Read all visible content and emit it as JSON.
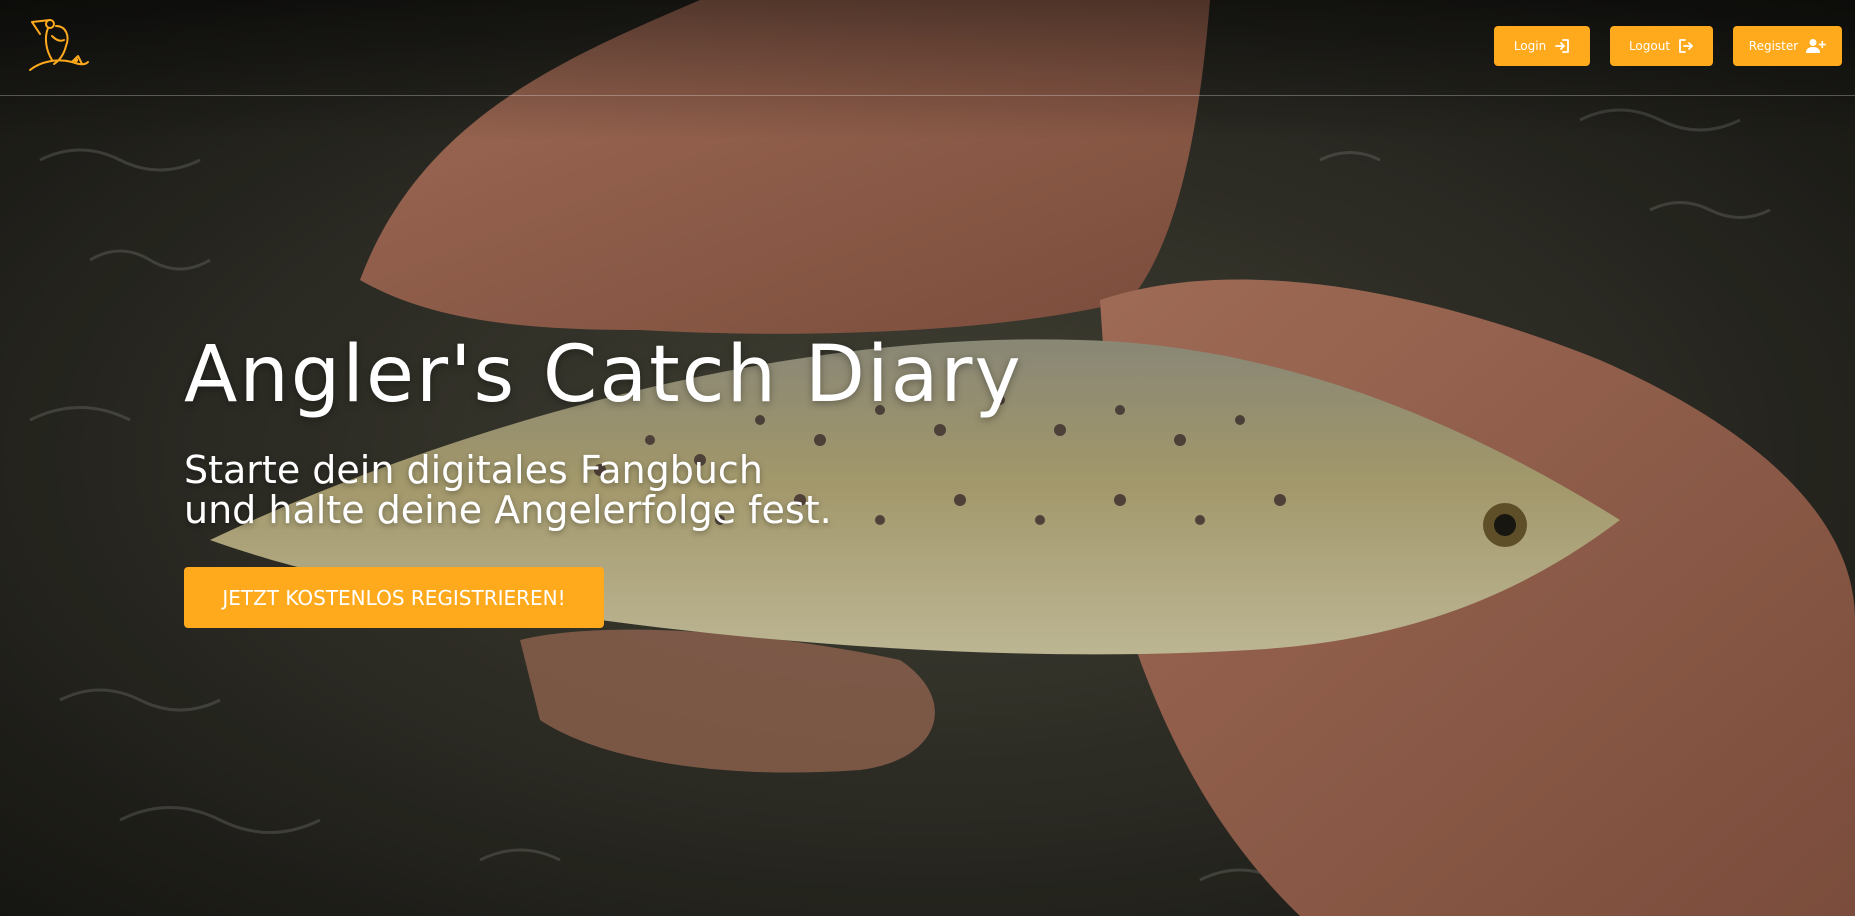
{
  "colors": {
    "accent": "#ffaa1d",
    "text": "#ffffff"
  },
  "header": {
    "logo_icon": "fisherman-logo-icon",
    "buttons": [
      {
        "label": "Login",
        "icon": "sign-in-icon"
      },
      {
        "label": "Logout",
        "icon": "sign-out-icon"
      },
      {
        "label": "Register",
        "icon": "user-plus-icon"
      }
    ]
  },
  "hero": {
    "title": "Angler's Catch Diary",
    "subtitle_line1": "Starte dein digitales Fangbuch",
    "subtitle_line2": "und halte deine Angelerfolge fest.",
    "cta_label": "JETZT KOSTENLOS REGISTRIEREN!",
    "background": "hand-holding-trout-in-water-photo"
  }
}
